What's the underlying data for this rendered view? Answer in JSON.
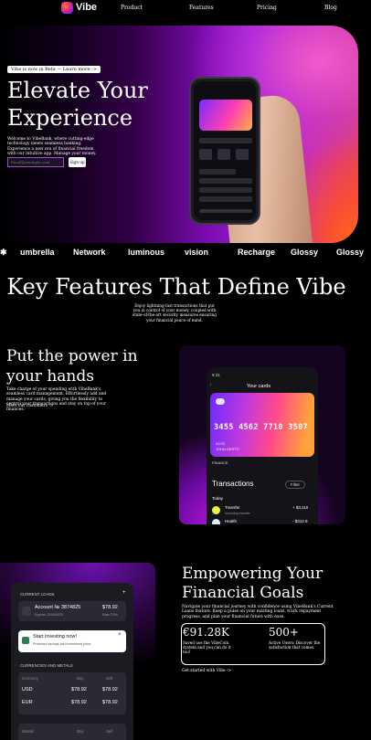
{
  "nav": {
    "brand": "Vibe",
    "links": [
      "Product",
      "Features",
      "Pricing",
      "Blog"
    ]
  },
  "hero": {
    "badge": "Vibe is now in Beta — Learn more ->",
    "title": "Elevate Your Experience",
    "description": "Welcome to VibeBank, where cutting-edge technology meets seamless banking. Experience a new era of financial freedom with our intuitive app. Manage your money.",
    "email_placeholder": "Email@example.com",
    "signup_label": "Sign up"
  },
  "logos": [
    "umbrella",
    "Network",
    "luminous",
    "vision",
    "Recharge",
    "Glossy",
    "Glossy"
  ],
  "features": {
    "title": "Key Features That Define Vibe",
    "description": "Enjoy lightning-fast transactions that put you in control of your money, coupled with state-of-the-art security measures ensuring your financial peace of mind."
  },
  "power": {
    "title": "Put the power in your hands",
    "description": "Take charge of your spending with VibeBank's seamless card management. Effortlessly add and manage your cards, giving you the flexibility to control your transactions and stay on top of your finances.",
    "link": "Meet our customers ->",
    "phone": {
      "time": "9:41",
      "screen_title": "Your cards",
      "card_number": "3455 4562 7710 3507",
      "expiry": "02/33",
      "holder": "JOHN DERTIT",
      "finance_label": "FINANCE",
      "transactions_title": "Transactions",
      "filter_label": "Filter",
      "today_label": "Today",
      "tx1_name": "Transfer",
      "tx1_sub": "Incoming transfer",
      "tx1_amount": "+ $3,110",
      "tx2_name": "Health",
      "tx2_amount": "- $312.9"
    }
  },
  "loans": {
    "section_label": "CURRENT LOANS",
    "account": "Account № 3874825",
    "account_sub": "Expires 12/09/2023",
    "amount": "$78.92",
    "amount_sub": "Rate 3.5%",
    "toast_title": "Start investing now!",
    "toast_sub": "Protected savings and investment plans",
    "fx_label": "CURRENCIES AND METALS",
    "fx_cols": [
      "Currency",
      "Buy",
      "Sell"
    ],
    "fx_rows": [
      {
        "code": "USD",
        "buy": "$78.92",
        "sell": "$78.92"
      },
      {
        "code": "EUR",
        "buy": "$78.92",
        "sell": "$78.92"
      }
    ],
    "metals_cols": [
      "Metals",
      "Buy",
      "Sell"
    ]
  },
  "goals": {
    "title": "Empowering Your Financial Goals",
    "description": "Navigate your financial journey with confidence using VibeBank's Current Loans feature. Keep a pulse on your existing loans, track repayment progress, and plan your financial future with ease.",
    "stat1_value": "€91.28K",
    "stat1_label": "Saved use the VibeCoin system and you can do it too!",
    "stat2_value": "500+",
    "stat2_label": "Active Users: Discover the satisfaction that comes.",
    "link": "Get started with Vibe ->"
  }
}
